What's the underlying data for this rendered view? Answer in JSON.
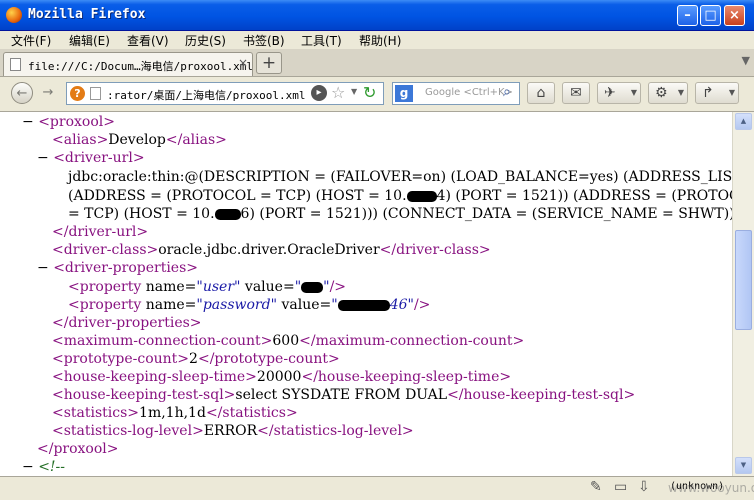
{
  "window": {
    "title": "Mozilla Firefox"
  },
  "menu": [
    "文件(F)",
    "编辑(E)",
    "查看(V)",
    "历史(S)",
    "书签(B)",
    "工具(T)",
    "帮助(H)"
  ],
  "tab": {
    "title": "file:///C:/Docum…海电信/proxool.xml",
    "close": "×",
    "new": "+"
  },
  "nav": {
    "back": "←",
    "forward": "→",
    "url": ":rator/桌面/上海电信/proxool.xml",
    "search_placeholder": "Google <Ctrl+K>"
  },
  "xml": {
    "root_open": "<proxool>",
    "alias_open": "<alias>",
    "alias_value": "Develop",
    "alias_close": "</alias>",
    "driver_url_open": "<driver-url>",
    "driver_url_line1": "jdbc:oracle:thin:@(DESCRIPTION = (FAILOVER=on) (LOAD_BALANCE=yes) (ADDRESS_LIST =",
    "driver_url_line2a": "(ADDRESS = (PROTOCOL = TCP) (HOST = 10.",
    "driver_url_line2b": "4) (PORT = 1521)) (ADDRESS = (PROTOCOL",
    "driver_url_line3a": "= TCP) (HOST = 10.",
    "driver_url_line3b": "6) (PORT = 1521))) (CONNECT_DATA = (SERVICE_NAME = SHWT)))",
    "driver_url_close": "</driver-url>",
    "driver_class_open": "<driver-class>",
    "driver_class_value": "oracle.jdbc.driver.OracleDriver",
    "driver_class_close": "</driver-class>",
    "driver_props_open": "<driver-properties>",
    "prop_tag": "<property",
    "name_attr": "name=",
    "value_attr": "value=",
    "self_close": "/>",
    "user_name": "\"user\"",
    "password_name": "\"password\"",
    "user_value_open": "\"",
    "user_value_close": "\"",
    "password_value_open": "\"",
    "password_value_close": "46\"",
    "driver_props_close": "</driver-properties>",
    "max_conn_open": "<maximum-connection-count>",
    "max_conn_value": "600",
    "max_conn_close": "</maximum-connection-count>",
    "proto_open": "<prototype-count>",
    "proto_value": "2",
    "proto_close": "</prototype-count>",
    "hk_sleep_open": "<house-keeping-sleep-time>",
    "hk_sleep_value": "20000",
    "hk_sleep_close": "</house-keeping-sleep-time>",
    "hk_sql_open": "<house-keeping-test-sql>",
    "hk_sql_value": "select SYSDATE FROM DUAL",
    "hk_sql_close": "</house-keeping-test-sql>",
    "stats_open": "<statistics>",
    "stats_value": "1m,1h,1d",
    "stats_close": "</statistics>",
    "stats_lvl_open": "<statistics-log-level>",
    "stats_lvl_value": "ERROR",
    "stats_lvl_close": "</statistics-log-level>",
    "root_close": "</proxool>",
    "comment_start": "<!--"
  },
  "collapse_glyph": "−",
  "status": {
    "text": "(unknown)"
  },
  "watermark": "www.wooyun.org",
  "colors": {
    "tag": "#881280",
    "attr_value": "#1a1aa6",
    "comment": "#236e25",
    "titlebar": "#0054e3"
  }
}
